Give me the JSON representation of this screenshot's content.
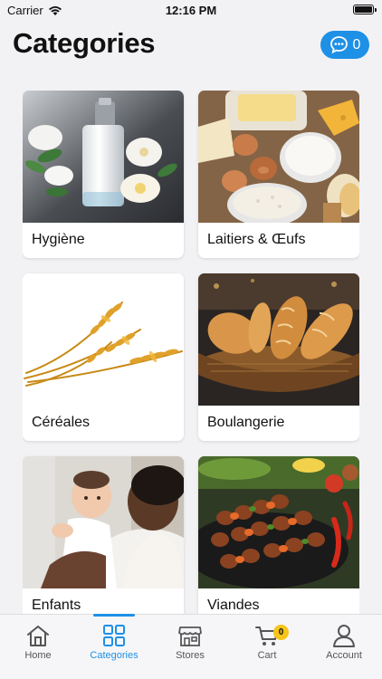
{
  "status_bar": {
    "carrier": "Carrier",
    "time": "12:16 PM"
  },
  "header": {
    "title": "Categories",
    "chat_count": "0"
  },
  "categories": [
    {
      "label": "Hygiène",
      "image": "skincare-bottle-image"
    },
    {
      "label": "Laitiers & Œufs",
      "image": "dairy-eggs-image"
    },
    {
      "label": "Céréales",
      "image": "wheat-image"
    },
    {
      "label": "Boulangerie",
      "image": "bread-basket-image"
    },
    {
      "label": "Enfants",
      "image": "mother-baby-image"
    },
    {
      "label": "Viandes",
      "image": "meat-skewers-image"
    }
  ],
  "tab_bar": {
    "items": [
      {
        "label": "Home",
        "icon": "home-icon"
      },
      {
        "label": "Categories",
        "icon": "grid-icon"
      },
      {
        "label": "Stores",
        "icon": "store-icon"
      },
      {
        "label": "Cart",
        "icon": "cart-icon"
      },
      {
        "label": "Account",
        "icon": "person-icon"
      }
    ],
    "active": "Categories",
    "cart_badge": "0"
  },
  "colors": {
    "accent": "#1e90e6",
    "badge": "#f5c518",
    "background": "#f2f2f4"
  }
}
